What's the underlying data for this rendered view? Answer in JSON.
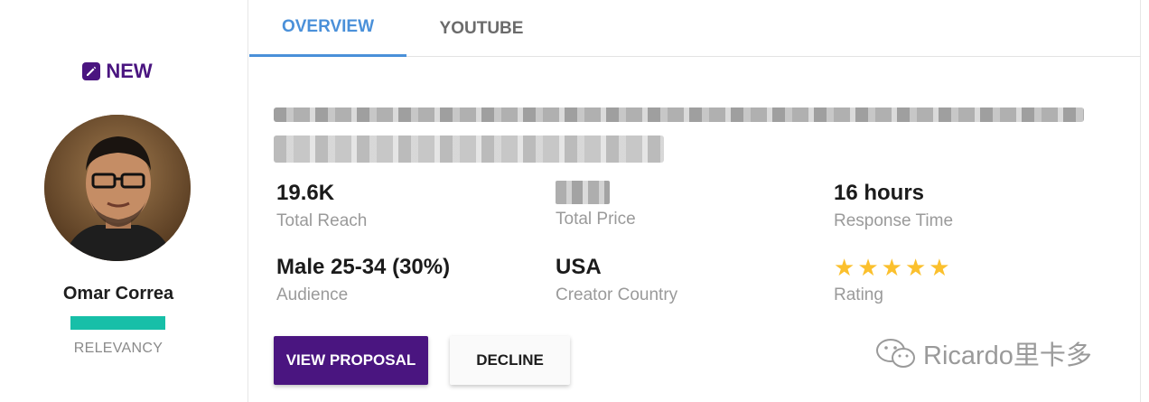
{
  "creator": {
    "badge": "NEW",
    "name": "Omar Correa",
    "relevancy_label": "RELEVANCY"
  },
  "tabs": [
    {
      "label": "OVERVIEW",
      "active": true
    },
    {
      "label": "YOUTUBE",
      "active": false
    }
  ],
  "stats": {
    "reach": {
      "value": "19.6K",
      "label": "Total Reach"
    },
    "price": {
      "label": "Total Price"
    },
    "response": {
      "value": "16 hours",
      "label": "Response Time"
    },
    "audience": {
      "value": "Male 25-34 (30%)",
      "label": "Audience"
    },
    "country": {
      "value": "USA",
      "label": "Creator Country"
    },
    "rating": {
      "label": "Rating",
      "stars": 5
    }
  },
  "actions": {
    "view_proposal": "VIEW PROPOSAL",
    "decline": "DECLINE"
  },
  "watermark": "Ricardo里卡多",
  "colors": {
    "brand_purple": "#4a1580",
    "tab_active": "#4a90d9",
    "relevancy": "#17bfa8",
    "star": "#fbc02d"
  }
}
